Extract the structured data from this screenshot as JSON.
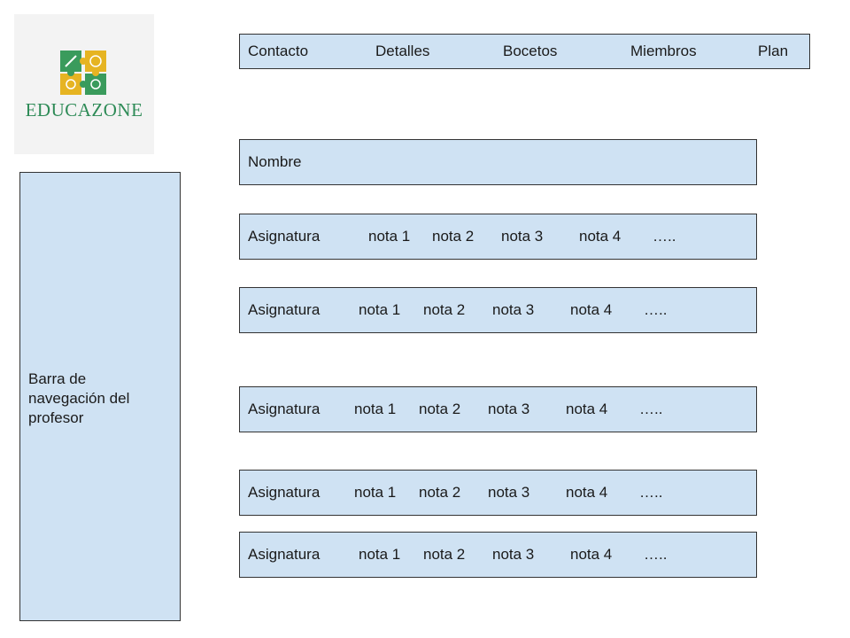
{
  "logo": {
    "text": "EDUCAZONE",
    "colors": [
      "#2e8b57",
      "#e6b422"
    ]
  },
  "nav": {
    "items": [
      "Contacto",
      "Detalles",
      "Bocetos",
      "Miembros",
      "Plan"
    ]
  },
  "sidebar": {
    "label": "Barra de\nnavegación del\nprofesor"
  },
  "name_field": {
    "label": "Nombre"
  },
  "subjects": [
    {
      "label": "Asignatura",
      "grades": [
        "nota 1",
        "nota 2",
        "nota 3",
        "nota 4"
      ],
      "more": "….."
    },
    {
      "label": "Asignatura",
      "grades": [
        "nota 1",
        "nota 2",
        "nota 3",
        "nota 4"
      ],
      "more": "….."
    },
    {
      "label": "Asignatura",
      "grades": [
        "nota 1",
        "nota 2",
        "nota 3",
        "nota 4"
      ],
      "more": "….."
    },
    {
      "label": "Asignatura",
      "grades": [
        "nota 1",
        "nota 2",
        "nota 3",
        "nota 4"
      ],
      "more": "….."
    },
    {
      "label": "Asignatura",
      "grades": [
        "nota 1",
        "nota 2",
        "nota 3",
        "nota 4"
      ],
      "more": "….."
    }
  ],
  "colors": {
    "box_fill": "#cfe2f3",
    "box_border": "#333333",
    "logo_bg": "#f3f3f3"
  }
}
